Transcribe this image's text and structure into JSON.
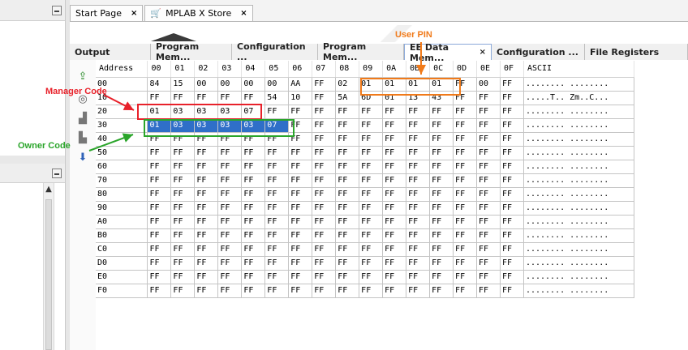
{
  "editor_tabs": [
    {
      "label": "Start Page",
      "close": "×"
    },
    {
      "label": "MPLAB X Store",
      "close": "×"
    }
  ],
  "output_tabs": [
    {
      "label": "Output",
      "active": false
    },
    {
      "label": "Program Mem...",
      "active": false
    },
    {
      "label": "Configuration ...",
      "active": false
    },
    {
      "label": "Program Mem...",
      "active": false
    },
    {
      "label": "EE Data Mem...",
      "active": true,
      "close": "×"
    },
    {
      "label": "Configuration ...",
      "active": false
    },
    {
      "label": "File Registers",
      "active": false
    }
  ],
  "memory": {
    "headers": [
      "Address",
      "00",
      "01",
      "02",
      "03",
      "04",
      "05",
      "06",
      "07",
      "08",
      "09",
      "0A",
      "0B",
      "0C",
      "0D",
      "0E",
      "0F",
      "ASCII"
    ],
    "rows": [
      {
        "addr": "00",
        "bytes": [
          "84",
          "15",
          "00",
          "00",
          "00",
          "00",
          "AA",
          "FF",
          "02",
          "01",
          "01",
          "01",
          "01",
          "FF",
          "00",
          "FF"
        ],
        "ascii": "........ ........"
      },
      {
        "addr": "10",
        "bytes": [
          "FF",
          "FF",
          "FF",
          "FF",
          "FF",
          "54",
          "10",
          "FF",
          "5A",
          "6D",
          "01",
          "13",
          "43",
          "FF",
          "FF",
          "FF"
        ],
        "ascii": ".....T.. Zm..C..."
      },
      {
        "addr": "20",
        "bytes": [
          "01",
          "03",
          "03",
          "03",
          "07",
          "FF",
          "FF",
          "FF",
          "FF",
          "FF",
          "FF",
          "FF",
          "FF",
          "FF",
          "FF",
          "FF"
        ],
        "ascii": "........ ........"
      },
      {
        "addr": "30",
        "bytes": [
          "01",
          "03",
          "03",
          "03",
          "03",
          "07",
          "FF",
          "FF",
          "FF",
          "FF",
          "FF",
          "FF",
          "FF",
          "FF",
          "FF",
          "FF"
        ],
        "ascii": "........ ........"
      },
      {
        "addr": "40",
        "bytes": [
          "FF",
          "FF",
          "FF",
          "FF",
          "FF",
          "FF",
          "FF",
          "FF",
          "FF",
          "FF",
          "FF",
          "FF",
          "FF",
          "FF",
          "FF",
          "FF"
        ],
        "ascii": "........ ........"
      },
      {
        "addr": "50",
        "bytes": [
          "FF",
          "FF",
          "FF",
          "FF",
          "FF",
          "FF",
          "FF",
          "FF",
          "FF",
          "FF",
          "FF",
          "FF",
          "FF",
          "FF",
          "FF",
          "FF"
        ],
        "ascii": "........ ........"
      },
      {
        "addr": "60",
        "bytes": [
          "FF",
          "FF",
          "FF",
          "FF",
          "FF",
          "FF",
          "FF",
          "FF",
          "FF",
          "FF",
          "FF",
          "FF",
          "FF",
          "FF",
          "FF",
          "FF"
        ],
        "ascii": "........ ........"
      },
      {
        "addr": "70",
        "bytes": [
          "FF",
          "FF",
          "FF",
          "FF",
          "FF",
          "FF",
          "FF",
          "FF",
          "FF",
          "FF",
          "FF",
          "FF",
          "FF",
          "FF",
          "FF",
          "FF"
        ],
        "ascii": "........ ........"
      },
      {
        "addr": "80",
        "bytes": [
          "FF",
          "FF",
          "FF",
          "FF",
          "FF",
          "FF",
          "FF",
          "FF",
          "FF",
          "FF",
          "FF",
          "FF",
          "FF",
          "FF",
          "FF",
          "FF"
        ],
        "ascii": "........ ........"
      },
      {
        "addr": "90",
        "bytes": [
          "FF",
          "FF",
          "FF",
          "FF",
          "FF",
          "FF",
          "FF",
          "FF",
          "FF",
          "FF",
          "FF",
          "FF",
          "FF",
          "FF",
          "FF",
          "FF"
        ],
        "ascii": "........ ........"
      },
      {
        "addr": "A0",
        "bytes": [
          "FF",
          "FF",
          "FF",
          "FF",
          "FF",
          "FF",
          "FF",
          "FF",
          "FF",
          "FF",
          "FF",
          "FF",
          "FF",
          "FF",
          "FF",
          "FF"
        ],
        "ascii": "........ ........"
      },
      {
        "addr": "B0",
        "bytes": [
          "FF",
          "FF",
          "FF",
          "FF",
          "FF",
          "FF",
          "FF",
          "FF",
          "FF",
          "FF",
          "FF",
          "FF",
          "FF",
          "FF",
          "FF",
          "FF"
        ],
        "ascii": "........ ........"
      },
      {
        "addr": "C0",
        "bytes": [
          "FF",
          "FF",
          "FF",
          "FF",
          "FF",
          "FF",
          "FF",
          "FF",
          "FF",
          "FF",
          "FF",
          "FF",
          "FF",
          "FF",
          "FF",
          "FF"
        ],
        "ascii": "........ ........"
      },
      {
        "addr": "D0",
        "bytes": [
          "FF",
          "FF",
          "FF",
          "FF",
          "FF",
          "FF",
          "FF",
          "FF",
          "FF",
          "FF",
          "FF",
          "FF",
          "FF",
          "FF",
          "FF",
          "FF"
        ],
        "ascii": "........ ........"
      },
      {
        "addr": "E0",
        "bytes": [
          "FF",
          "FF",
          "FF",
          "FF",
          "FF",
          "FF",
          "FF",
          "FF",
          "FF",
          "FF",
          "FF",
          "FF",
          "FF",
          "FF",
          "FF",
          "FF"
        ],
        "ascii": "........ ........"
      },
      {
        "addr": "F0",
        "bytes": [
          "FF",
          "FF",
          "FF",
          "FF",
          "FF",
          "FF",
          "FF",
          "FF",
          "FF",
          "FF",
          "FF",
          "FF",
          "FF",
          "FF",
          "FF",
          "FF"
        ],
        "ascii": "........ ........"
      }
    ],
    "selection": {
      "row": "30",
      "from_col": "00",
      "to_col": "05"
    }
  },
  "annotations": {
    "user_pin": {
      "label": "User PIN",
      "color": "#f07a1a"
    },
    "manager_code": {
      "label": "Manager Code",
      "color": "#e8212a"
    },
    "owner_code": {
      "label": "Owner Code",
      "color": "#2aa52a"
    }
  },
  "icons": {
    "cart": "cart-icon",
    "tools": [
      "import-icon",
      "refresh-icon",
      "step-icon",
      "move-icon",
      "down-arrow-icon"
    ]
  },
  "colors": {
    "selection": "#2f6fc8",
    "active_tab_border": "#8aa8d8"
  }
}
